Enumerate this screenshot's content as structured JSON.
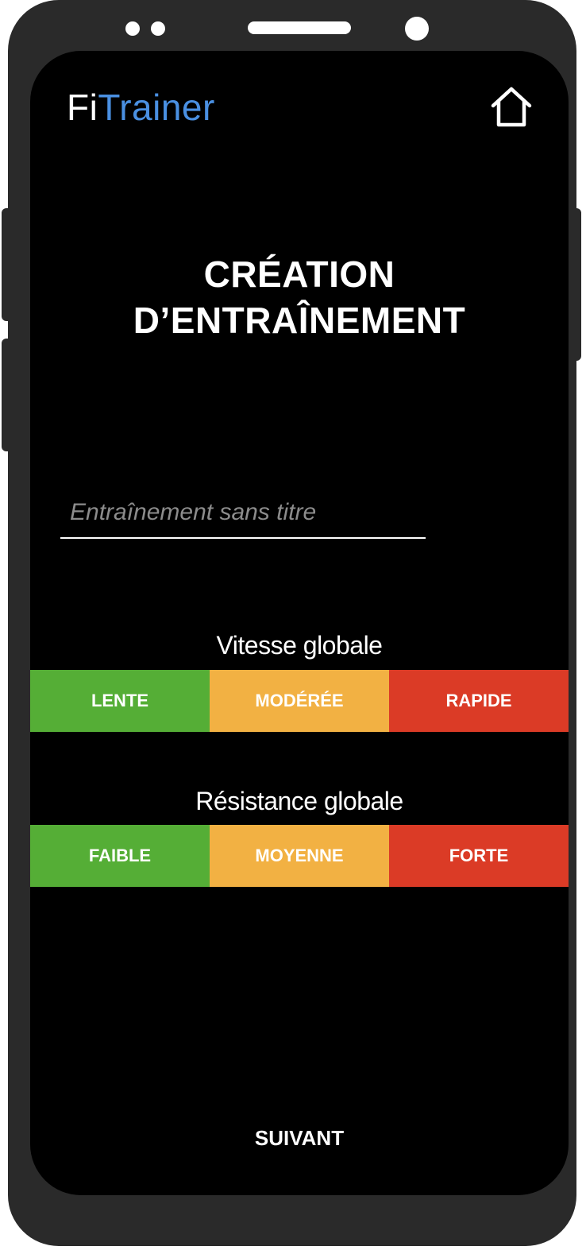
{
  "header": {
    "logo_part1": "Fi",
    "logo_part2": "Trainer",
    "home_icon": "home-icon"
  },
  "page": {
    "title_line1": "CRÉATION",
    "title_line2": "D’ENTRAÎNEMENT"
  },
  "workout_name": {
    "placeholder": "Entraînement sans titre",
    "value": ""
  },
  "speed": {
    "label": "Vitesse globale",
    "options": [
      "LENTE",
      "MODÉRÉE",
      "RAPIDE"
    ]
  },
  "resistance": {
    "label": "Résistance globale",
    "options": [
      "FAIBLE",
      "MOYENNE",
      "FORTE"
    ]
  },
  "footer": {
    "next_label": "SUIVANT"
  },
  "colors": {
    "brand": "#4a90e2",
    "low": "#55ae36",
    "medium": "#f2b143",
    "high": "#db3b26"
  }
}
